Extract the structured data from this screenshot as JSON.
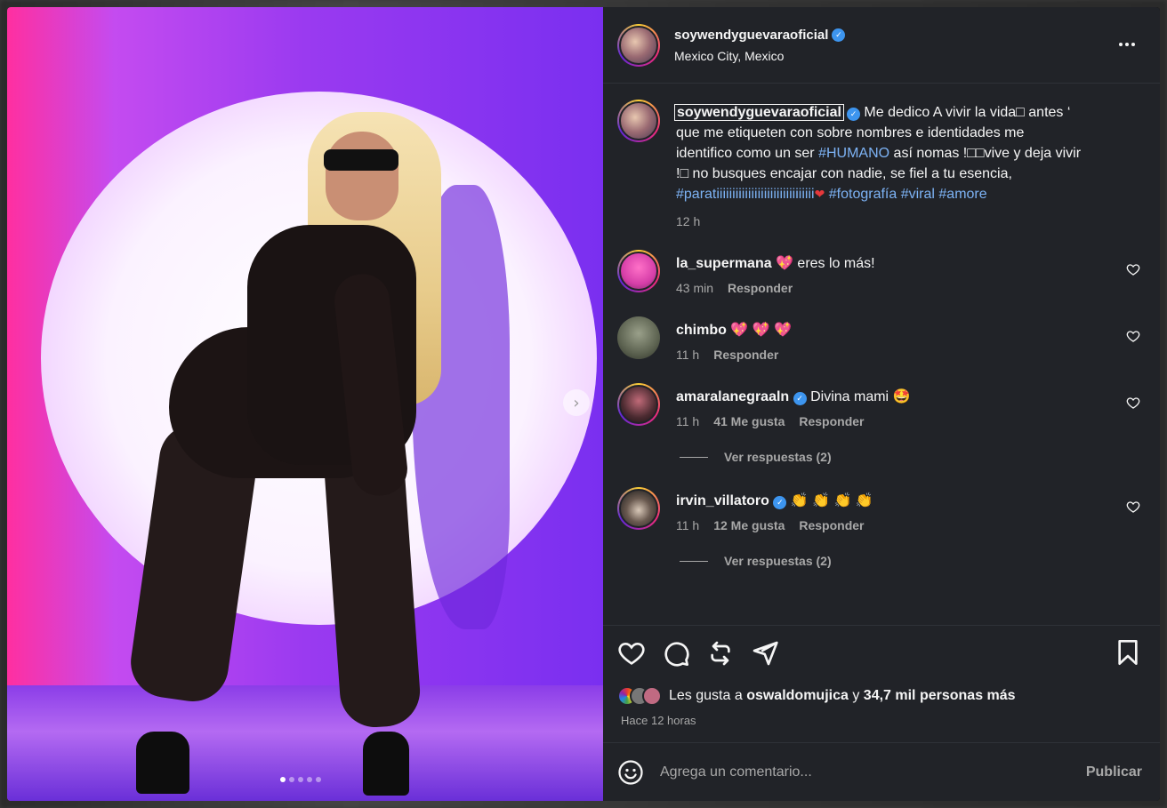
{
  "post": {
    "username": "soywendyguevaraoficial",
    "location": "Mexico City, Mexico",
    "caption": {
      "username": "soywendyguevaraoficial",
      "text_1": " Me dedico A vivir la vida□ antes ‘ que me etiqueten con sobre nombres e identidades me identifico como un ser ",
      "tag_humano": "#HUMANO",
      "text_2": " así nomas !□□vive y deja vivir !□ no busques encajar con nadie, se fiel a tu esencia, ",
      "tag_parati": "#paratiiiiiiiiiiiiiiiiiiiiiiiiiiiiiii",
      "heart": "❤",
      "tag_foto": "#fotografía",
      "tag_viral": "#viral",
      "tag_amore": "#amore",
      "time": "12 h"
    },
    "carousel": {
      "slides": 5,
      "active": 0
    }
  },
  "comments": [
    {
      "user": "la_supermana",
      "text": "💖 eres lo más!",
      "time": "43 min",
      "likes": "",
      "reply": "Responder",
      "verified": false
    },
    {
      "user": "chimbo",
      "text": "💖 💖 💖",
      "time": "11 h",
      "likes": "",
      "reply": "Responder",
      "verified": false
    },
    {
      "user": "amaralanegraaln",
      "text": "Divina mami 🤩",
      "time": "11 h",
      "likes": "41 Me gusta",
      "reply": "Responder",
      "verified": true,
      "replies": "Ver respuestas (2)"
    },
    {
      "user": "irvin_villatoro",
      "text": "👏 👏 👏 👏",
      "time": "11 h",
      "likes": "12 Me gusta",
      "reply": "Responder",
      "verified": true,
      "replies": "Ver respuestas (2)"
    }
  ],
  "likes": {
    "prefix": "Les gusta a",
    "user": "oswaldomujica",
    "connector": "y",
    "count": "34,7 mil personas más"
  },
  "time_ago": "Hace 12 horas",
  "composer": {
    "placeholder": "Agrega un comentario...",
    "publish": "Publicar"
  },
  "colors": {
    "panel_bg": "#212328",
    "hashtag": "#7db3f5",
    "verified": "#3d95ef",
    "muted_text": "#a8a8a8"
  }
}
